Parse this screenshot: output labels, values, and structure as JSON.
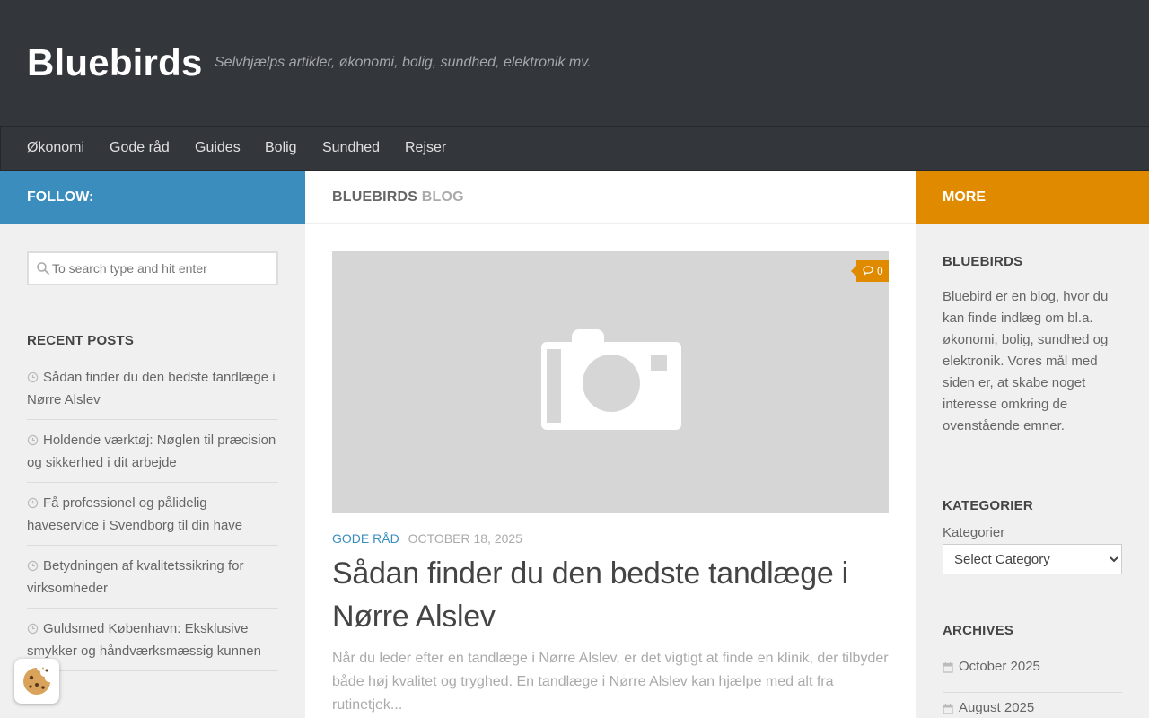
{
  "header": {
    "site_title": "Bluebirds",
    "tagline": "Selvhjælps artikler, økonomi, bolig, sundhed, elektronik mv."
  },
  "nav": {
    "items": [
      {
        "label": "Økonomi"
      },
      {
        "label": "Gode råd"
      },
      {
        "label": "Guides"
      },
      {
        "label": "Bolig"
      },
      {
        "label": "Sundhed"
      },
      {
        "label": "Rejser"
      }
    ]
  },
  "left_sidebar": {
    "follow_label": "FOLLOW:",
    "search_placeholder": "To search type and hit enter",
    "recent_title": "RECENT POSTS",
    "recent_posts": [
      {
        "title": "Sådan finder du den bedste tandlæge i Nørre Alslev"
      },
      {
        "title": "Holdende værktøj: Nøglen til præcision og sikkerhed i dit arbejde"
      },
      {
        "title": "Få professionel og pålidelig haveservice i Svendborg til din have"
      },
      {
        "title": "Betydningen af kvalitetssikring for virksomheder"
      },
      {
        "title": "Guldsmed København: Eksklusive smykker og håndværksmæssig kunnen"
      }
    ]
  },
  "main": {
    "heading_strong": "BLUEBIRDS",
    "heading_muted": "BLOG",
    "post": {
      "comment_count": "0",
      "category": "GODE RÅD",
      "date": "OCTOBER 18, 2025",
      "title": "Sådan finder du den bedste tandlæge i Nørre Alslev",
      "excerpt": "Når du leder efter en tandlæge i Nørre Alslev, er det vigtigt at finde en klinik, der tilbyder både høj kvalitet og tryghed. En tandlæge i Nørre Alslev kan hjælpe med alt fra rutinetjek..."
    }
  },
  "right_sidebar": {
    "more_label": "MORE",
    "about_title": "BLUEBIRDS",
    "about_text": "Bluebird er en blog, hvor du kan finde indlæg om bl.a. økonomi, bolig, sundhed og elektronik. Vores mål med siden er, at skabe noget interesse omkring de ovenstående emner.",
    "categories_title": "KATEGORIER",
    "categories_label": "Kategorier",
    "categories_selected": "Select Category",
    "archives_title": "ARCHIVES",
    "archives": [
      {
        "label": "October 2025"
      },
      {
        "label": "August 2025"
      }
    ]
  },
  "colors": {
    "header_bg": "#33363b",
    "accent_blue": "#3b8dbd",
    "accent_orange": "#e08a00"
  },
  "icons": [
    "search-icon",
    "clock-icon",
    "camera-icon",
    "comment-icon",
    "calendar-icon",
    "cookie-icon"
  ]
}
